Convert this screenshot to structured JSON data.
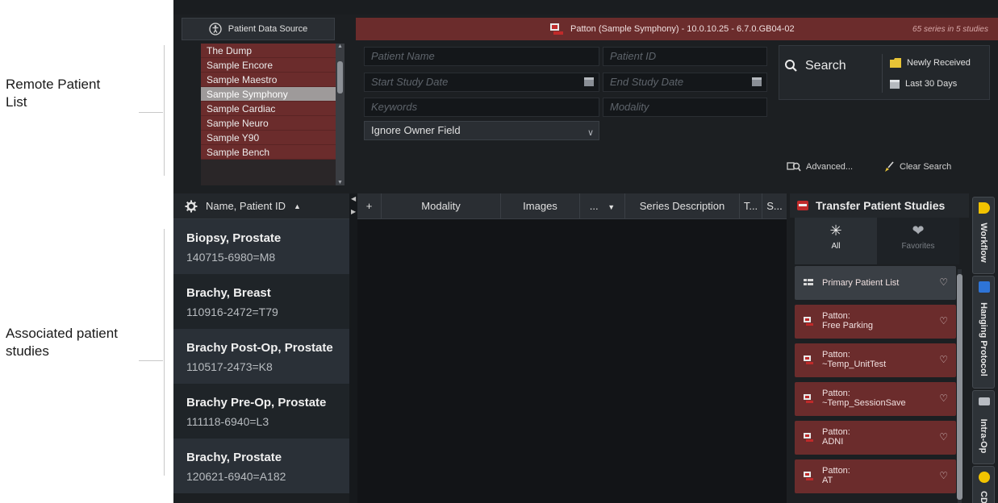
{
  "annotations": {
    "remote_list": "Remote Patient\nList",
    "associated": "Associated patient\nstudies"
  },
  "data_source": {
    "header": "Patient Data Source",
    "items": [
      "The Dump",
      "Sample Encore",
      "Sample Maestro",
      "Sample Symphony",
      "Sample Cardiac",
      "Sample Neuro",
      "Sample Y90",
      "Sample Bench"
    ],
    "selected": "Sample Symphony"
  },
  "search": {
    "title": "Patton (Sample Symphony) - 10.0.10.25 - 6.7.0.GB04-02",
    "count": "65 series in 5 studies",
    "patient_name_ph": "Patient Name",
    "patient_id_ph": "Patient ID",
    "start_date_ph": "Start Study Date",
    "end_date_ph": "End Study Date",
    "keywords_ph": "Keywords",
    "modality_ph": "Modality",
    "owner_filter": "Ignore Owner Field",
    "search_label": "Search",
    "newly_received": "Newly Received",
    "last_30_days": "Last 30 Days",
    "advanced": "Advanced...",
    "clear_search": "Clear Search"
  },
  "patient_list": {
    "sort_header": "Name, Patient ID",
    "patients": [
      {
        "name": "Biopsy, Prostate",
        "id": "140715-6980=M8"
      },
      {
        "name": "Brachy, Breast",
        "id": "110916-2472=T79"
      },
      {
        "name": "Brachy Post-Op, Prostate",
        "id": "110517-2473=K8"
      },
      {
        "name": "Brachy Pre-Op, Prostate",
        "id": "111118-6940=L3"
      },
      {
        "name": "Brachy, Prostate",
        "id": "120621-6940=A182"
      }
    ]
  },
  "series_grid": {
    "columns": {
      "plus": "+",
      "modality": "Modality",
      "images": "Images",
      "more": "...",
      "series_description": "Series Description",
      "t": "T...",
      "s": "S..."
    }
  },
  "transfer": {
    "header": "Transfer Patient Studies",
    "tab_all": "All",
    "tab_favorites": "Favorites",
    "items": [
      {
        "l1": "Primary Patient List",
        "l2": ""
      },
      {
        "l1": "Patton:",
        "l2": "Free Parking"
      },
      {
        "l1": "Patton:",
        "l2": "~Temp_UnitTest"
      },
      {
        "l1": "Patton:",
        "l2": "~Temp_SessionSave"
      },
      {
        "l1": "Patton:",
        "l2": "ADNI"
      },
      {
        "l1": "Patton:",
        "l2": "AT"
      }
    ]
  },
  "side_tabs": [
    "Workflow",
    "Hanging Protocol",
    "Intra-Op",
    "CD"
  ],
  "colors": {
    "maroon": "#6b2c2c",
    "selected": "#9e9a9a",
    "workflow_accent": "#f2c300",
    "hanging_accent": "#2e74d6"
  }
}
